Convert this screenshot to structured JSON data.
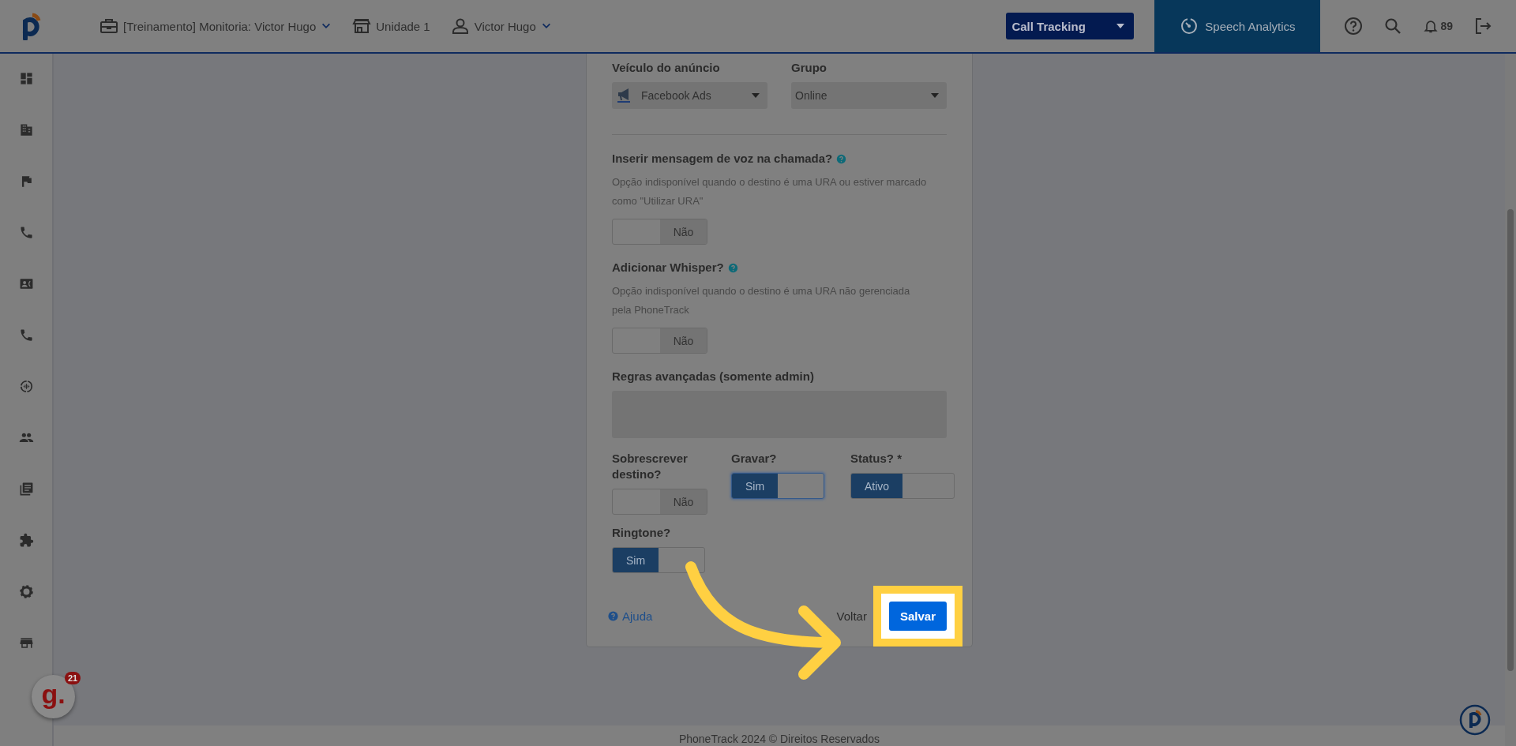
{
  "header": {
    "workspace": "[Treinamento] Monitoria: Victor Hugo",
    "unit": "Unidade 1",
    "user": "Victor Hugo",
    "product_select": "Call Tracking",
    "speech_analytics": "Speech Analytics",
    "notifications": "89"
  },
  "form": {
    "selects": [
      {
        "label": "Veículo do anúncio",
        "value": "Facebook Ads",
        "kind": "icon"
      },
      {
        "label": "Grupo",
        "value": "Online",
        "kind": "plain"
      }
    ],
    "options": [
      {
        "label": "Inserir mensagem de voz na chamada?",
        "help": "Opção indisponível quando o destino é uma URA ou estiver marcado como \"Utilizar URA\"",
        "toggle": {
          "on": false,
          "text": "Não"
        }
      },
      {
        "label": "Adicionar Whisper?",
        "help": "Opção indisponível quando o destino é uma URA não gerenciada pela PhoneTrack",
        "toggle": {
          "on": false,
          "text": "Não"
        }
      }
    ],
    "advanced_rules": {
      "label": "Regras avançadas (somente admin)"
    },
    "switches": [
      {
        "label": "Sobrescrever destino?",
        "on": false,
        "text": "Não",
        "focused": false
      },
      {
        "label": "Gravar?",
        "on": true,
        "text": "Sim",
        "focused": true
      },
      {
        "label": "Status? *",
        "on": true,
        "text": "Ativo",
        "focused": false
      },
      {
        "label": "Ringtone?",
        "on": true,
        "text": "Sim",
        "focused": false
      }
    ],
    "help_link": "Ajuda",
    "back": "Voltar",
    "save": "Salvar"
  },
  "chat_widget": {
    "logo": "g.",
    "count": "21"
  },
  "footer": "PhoneTrack 2024 © Direitos Reservados"
}
